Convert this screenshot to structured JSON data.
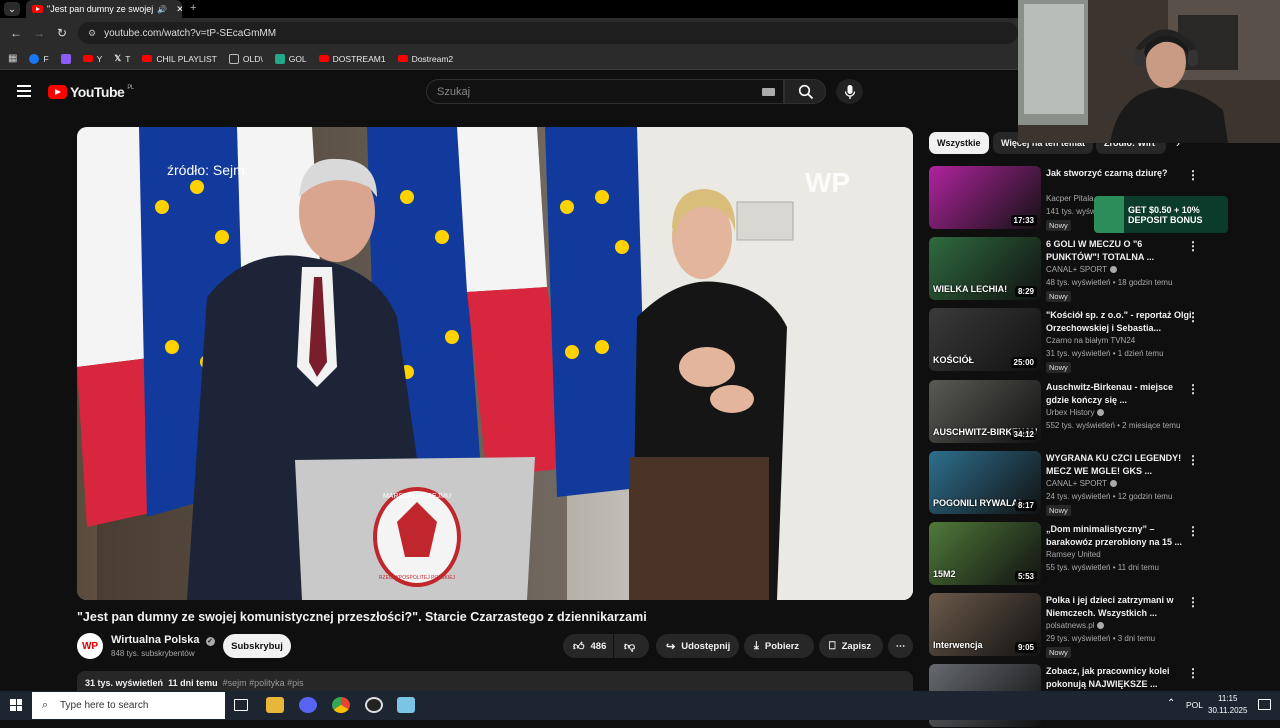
{
  "browser": {
    "tab_title": "\"Jest pan dumny ze swojej",
    "url": "youtube.com/watch?v=tP-SEcaGmMM",
    "bookmarks": [
      {
        "label": "F",
        "color": "#1877f2"
      },
      {
        "label": "",
        "color": "#8b5cf6"
      },
      {
        "label": "Y",
        "color": "#ff0000"
      },
      {
        "label": "T",
        "color": "#444444"
      },
      {
        "label": "CHIL PLAYLIST",
        "color": "#ff0000"
      },
      {
        "label": "OLD\\",
        "color": "#aaaaaa"
      },
      {
        "label": "GOL",
        "color": "#22aa88"
      },
      {
        "label": "DOSTREAM1",
        "color": "#ff0000"
      },
      {
        "label": "Dostream2",
        "color": "#ff0000"
      }
    ]
  },
  "youtube": {
    "logo_text": "YouTube",
    "logo_region": "PL",
    "search_placeholder": "Szukaj",
    "accent": "#ff0000"
  },
  "video": {
    "overlay_source": "źródło: Sejm",
    "watermark": "WP",
    "emblem_top": "MARSZAŁEK SEJMU",
    "emblem_bottom": "RZECZYPOSPOLITEJ POLSKIEJ",
    "title": "\"Jest pan dumny ze swojej komunistycznej przeszłości?\". Starcie Czarzastego z dziennikarzami",
    "channel": "Wirtualna Polska",
    "channel_avatar": "WP",
    "subscribers": "848 tys. subskrybentów",
    "subscribe_label": "Subskrybuj",
    "likes": "486",
    "share_label": "Udostępnij",
    "download_label": "Pobierz",
    "save_label": "Zapisz",
    "views": "31 tys. wyświetleń",
    "age": "11 dni temu",
    "tags": "#sejm #polityka #pis"
  },
  "chips": [
    "Wszystkie",
    "Więcej na ten temat",
    "Źródło: Wirt"
  ],
  "recommendations": [
    {
      "title": "Jak stworzyć czarną dziurę?",
      "channel": "Kacper Pitala",
      "meta": "141 tys. wyświ",
      "duration": "17:33",
      "badge": "Nowy",
      "verified": false,
      "thumb": "#b0249e",
      "thumb_text": ""
    },
    {
      "title": "6 GOLI W MECZU O \"6 PUNKTÓW\"! TOTALNA ...",
      "channel": "CANAL+ SPORT",
      "meta": "48 tys. wyświetleń • 18 godzin temu",
      "duration": "8:29",
      "badge": "Nowy",
      "verified": true,
      "thumb": "#2f6b3f",
      "thumb_text": "WIELKA LECHIA!"
    },
    {
      "title": "\"Kościół sp. z o.o.\" - reportaż Olgi Orzechowskiej i Sebastia...",
      "channel": "Czarno na białym TVN24",
      "meta": "31 tys. wyświetleń • 1 dzień temu",
      "duration": "25:00",
      "badge": "Nowy",
      "verified": false,
      "thumb": "#3a3a3a",
      "thumb_text": "KOŚCIÓŁ"
    },
    {
      "title": "Auschwitz-Birkenau - miejsce gdzie kończy się ...",
      "channel": "Urbex History",
      "meta": "552 tys. wyświetleń • 2 miesiące temu",
      "duration": "34:12",
      "badge": "",
      "verified": true,
      "thumb": "#5a5a55",
      "thumb_text": "AUSCHWITZ-BIRKENAU"
    },
    {
      "title": "WYGRANA KU CZCI LEGENDY! MECZ WE MGLE! GKS ...",
      "channel": "CANAL+ SPORT",
      "meta": "24 tys. wyświetleń • 12 godzin temu",
      "duration": "8:17",
      "badge": "Nowy",
      "verified": true,
      "thumb": "#2e6f8e",
      "thumb_text": "POGONILI RYWALA!"
    },
    {
      "title": "„Dom minimalistyczny” – barakowóz przerobiony na 15 ...",
      "channel": "Ramsey United",
      "meta": "55 tys. wyświetleń • 11 dni temu",
      "duration": "5:53",
      "badge": "",
      "verified": false,
      "thumb": "#4f7a3a",
      "thumb_text": "15M2"
    },
    {
      "title": "Polka i jej dzieci zatrzymani w Niemczech. Wszystkich ...",
      "channel": "polsatnews.pl",
      "meta": "29 tys. wyświetleń • 3 dni temu",
      "duration": "9:05",
      "badge": "Nowy",
      "verified": true,
      "thumb": "#6b5a4a",
      "thumb_text": "Interwencja"
    },
    {
      "title": "Zobacz, jak pracownicy kolei pokonują NAJWIĘKSZE ...",
      "channel": "",
      "meta": "",
      "duration": "",
      "badge": "",
      "verified": false,
      "thumb": "#666a70",
      "thumb_text": ""
    }
  ],
  "ad_banner": "GET $0.50 + 10% DEPOSIT BONUS",
  "taskbar": {
    "search_placeholder": "Type here to search",
    "language": "POL",
    "time": "11:15",
    "date": "30.11.2025"
  }
}
